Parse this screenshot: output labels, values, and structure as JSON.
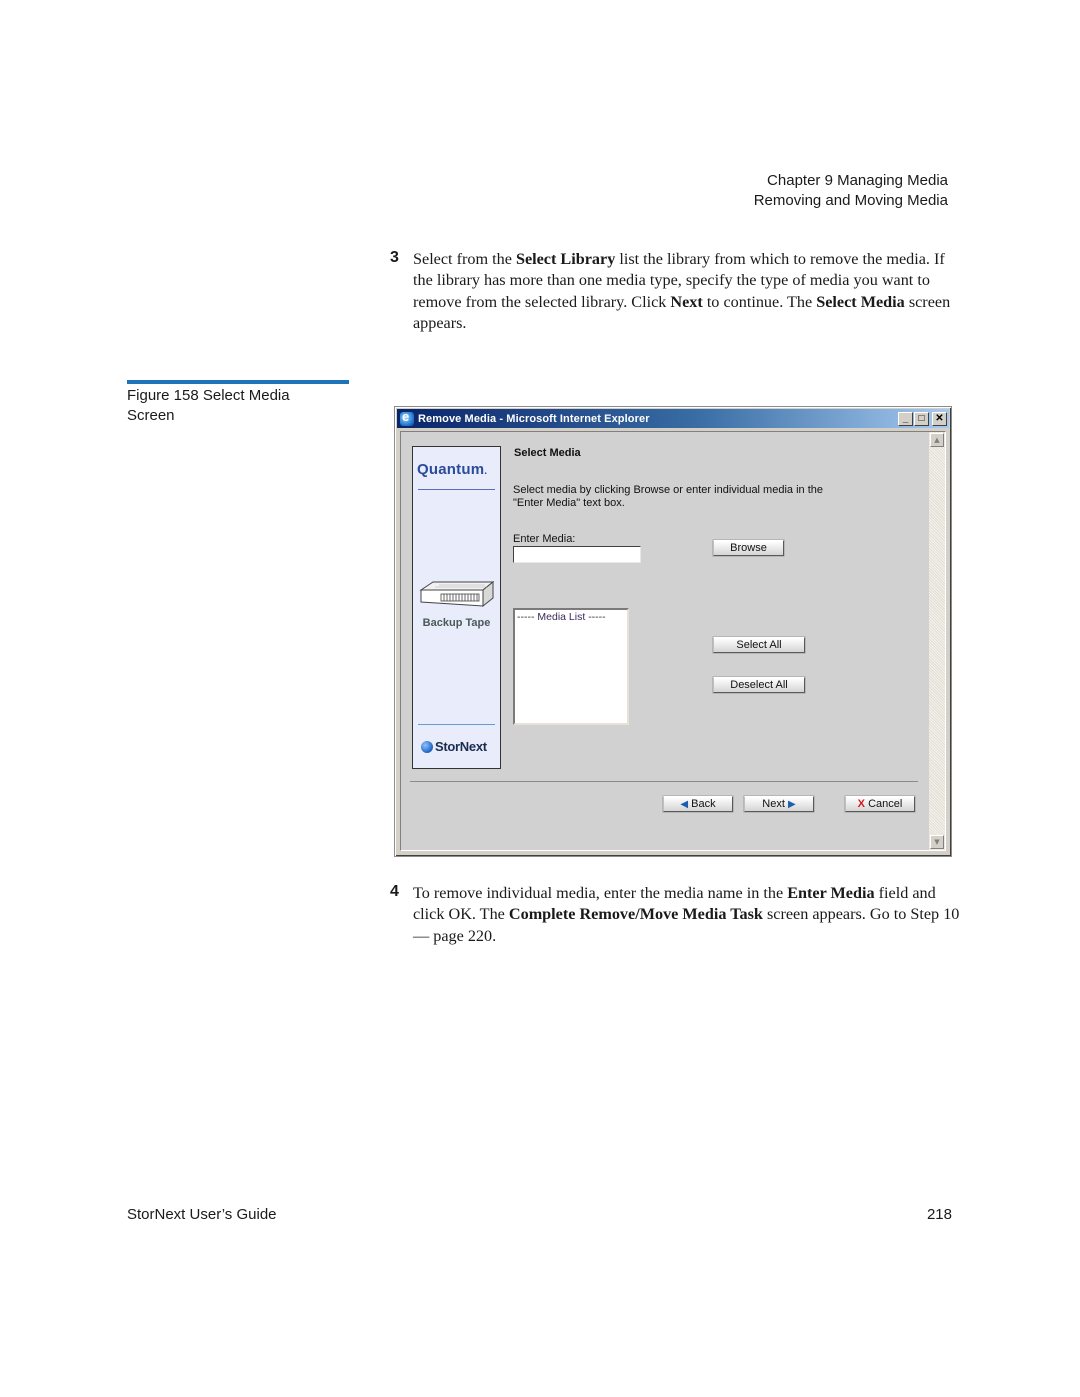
{
  "header": {
    "chapter": "Chapter 9  Managing Media",
    "section": "Removing and Moving Media"
  },
  "steps": [
    {
      "number": "3",
      "segments": [
        {
          "text": "Select from the ",
          "bold": false
        },
        {
          "text": "Select Library",
          "bold": true
        },
        {
          "text": " list the library from which to remove the media. If the library has more than one media type, specify the type of media you want to remove from the selected library. Click ",
          "bold": false
        },
        {
          "text": "Next",
          "bold": true
        },
        {
          "text": " to continue. The ",
          "bold": false
        },
        {
          "text": "Select Media",
          "bold": true
        },
        {
          "text": " screen appears.",
          "bold": false
        }
      ]
    },
    {
      "number": "4",
      "segments": [
        {
          "text": "To remove individual media, enter the media name in the ",
          "bold": false
        },
        {
          "text": "Enter Media",
          "bold": true
        },
        {
          "text": " field and click OK. The ",
          "bold": false
        },
        {
          "text": "Complete Remove/Move Media Task",
          "bold": true
        },
        {
          "text": " screen appears. Go to Step 10— page 220.",
          "bold": false
        }
      ]
    }
  ],
  "figure": {
    "caption_line1": "Figure 158  Select Media",
    "caption_line2": "Screen",
    "accent_color": "#1f74b9"
  },
  "window": {
    "title": "Remove Media - Microsoft Internet Explorer",
    "controls": {
      "minimize": "_",
      "maximize": "□",
      "close": "✕"
    },
    "sidebar": {
      "brand_logo": "Quantum",
      "brand_logo_mark": ".",
      "product_icon": "backup-tape-icon",
      "product_label": "Backup Tape",
      "footer_logo": "StorNext"
    },
    "form": {
      "title": "Select Media",
      "description": "Select media by clicking Browse or enter individual media in the \"Enter Media\" text box.",
      "enter_media_label": "Enter Media:",
      "enter_media_value": "",
      "browse_label": "Browse",
      "media_list_header_dashes_left": "-----",
      "media_list_header": "Media List",
      "media_list_header_dashes_right": "-----",
      "select_all_label": "Select All",
      "deselect_all_label": "Deselect All"
    },
    "nav": {
      "back_label": "Back",
      "next_label": "Next",
      "cancel_label": "Cancel"
    }
  },
  "footer": {
    "guide_title": "StorNext User’s Guide",
    "page_number": "218"
  }
}
